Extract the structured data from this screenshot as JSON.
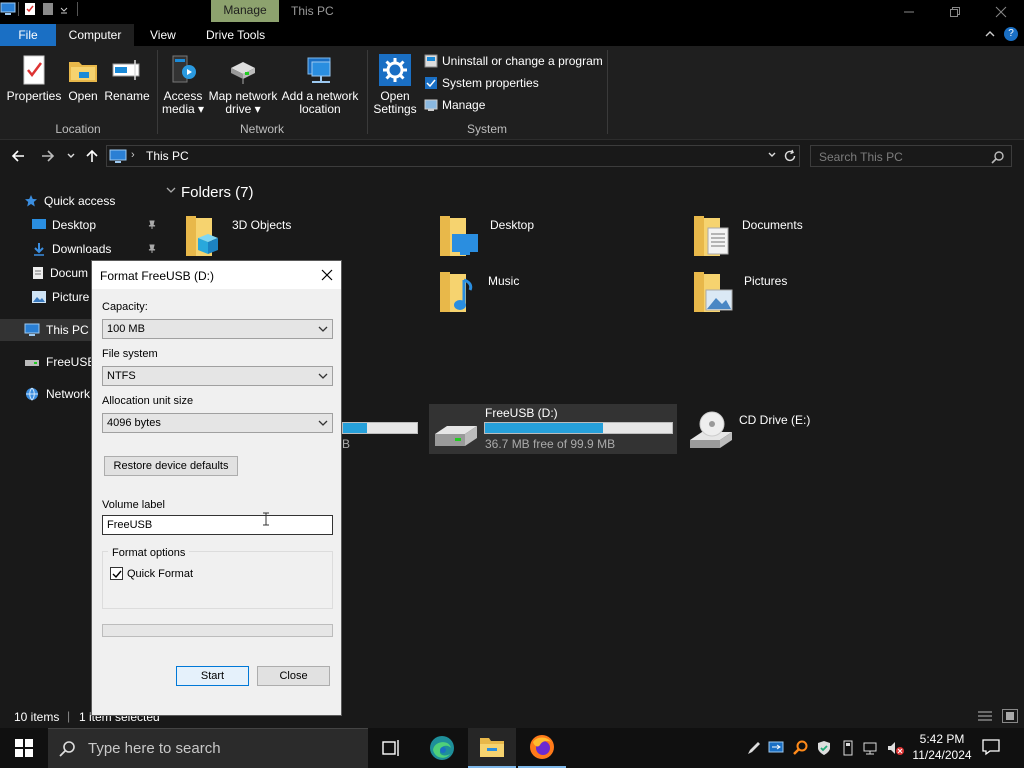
{
  "window": {
    "title": "This PC",
    "context_tab": "Manage"
  },
  "ribbon": {
    "tabs": [
      "File",
      "Computer",
      "View",
      "Drive Tools"
    ],
    "location_group": {
      "label": "Location",
      "buttons": [
        "Properties",
        "Open",
        "Rename"
      ]
    },
    "network_group": {
      "label": "Network",
      "access_media": [
        "Access",
        "media"
      ],
      "map_drive": [
        "Map network",
        "drive"
      ],
      "add_location": [
        "Add a network",
        "location"
      ]
    },
    "system_group": {
      "label": "System",
      "open_settings": [
        "Open",
        "Settings"
      ],
      "items": [
        "Uninstall or change a program",
        "System properties",
        "Manage"
      ]
    }
  },
  "address": {
    "path": "This PC",
    "search_placeholder": "Search This PC"
  },
  "nav": {
    "quick_access": "Quick access",
    "desktop": "Desktop",
    "downloads": "Downloads",
    "documents": "Docum",
    "pictures": "Picture",
    "this_pc": "This PC",
    "freeusb": "FreeUSB",
    "network": "Network"
  },
  "content": {
    "folders_header": "Folders (7)",
    "folders": [
      "3D Objects",
      "Desktop",
      "Documents",
      "Music",
      "Pictures"
    ],
    "drive_c_partial": "B",
    "drive_d": {
      "name": "FreeUSB (D:)",
      "free": "36.7 MB free of 99.9 MB",
      "used_fraction": 0.63
    },
    "drive_e": {
      "name": "CD Drive (E:)"
    },
    "drive_c_used_fraction": 0.33
  },
  "status": {
    "items": "10 items",
    "selected": "1 item selected"
  },
  "dialog": {
    "title": "Format FreeUSB (D:)",
    "capacity_label": "Capacity:",
    "capacity_value": "100 MB",
    "fs_label": "File system",
    "fs_value": "NTFS",
    "alloc_label": "Allocation unit size",
    "alloc_value": "4096 bytes",
    "restore_btn": "Restore device defaults",
    "volume_label": "Volume label",
    "volume_value": "FreeUSB",
    "format_options": "Format options",
    "quick_format": "Quick Format",
    "start_btn": "Start",
    "close_btn": "Close"
  },
  "taskbar": {
    "search_placeholder": "Type here to search",
    "time": "5:42 PM",
    "date": "11/24/2024"
  },
  "colors": {
    "accent": "#1a6fc4",
    "manage_tab": "#8da26e",
    "drive_fill": "#26a0da"
  }
}
